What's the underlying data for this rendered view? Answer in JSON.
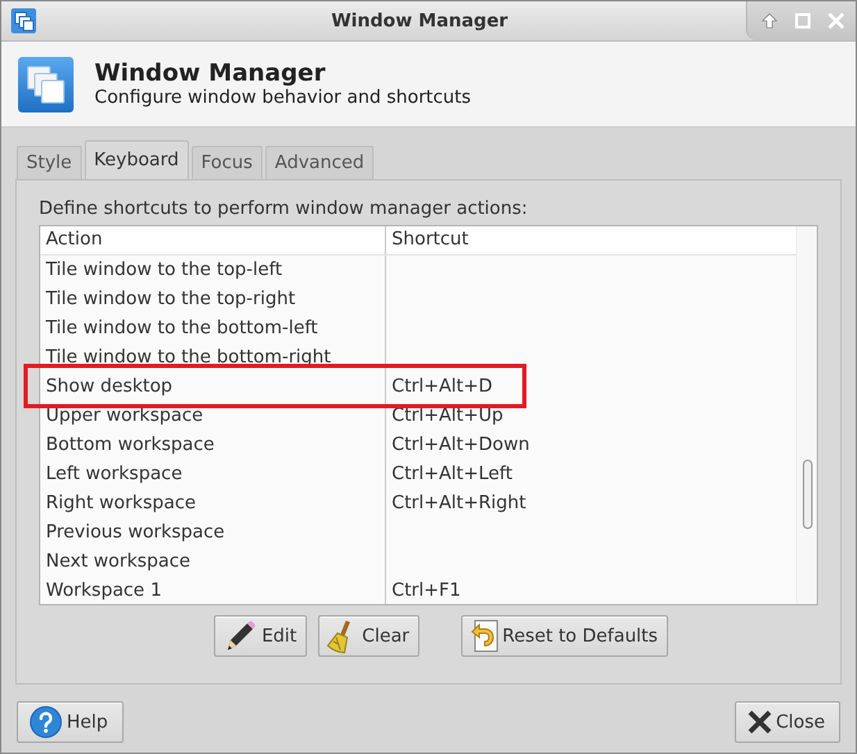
{
  "window": {
    "title": "Window Manager"
  },
  "header": {
    "title": "Window Manager",
    "subtitle": "Configure window behavior and shortcuts"
  },
  "tabs": [
    {
      "label": "Style",
      "selected": false
    },
    {
      "label": "Keyboard",
      "selected": true
    },
    {
      "label": "Focus",
      "selected": false
    },
    {
      "label": "Advanced",
      "selected": false
    }
  ],
  "instructions": "Define shortcuts to perform window manager actions:",
  "table": {
    "columns": [
      "Action",
      "Shortcut"
    ],
    "rows": [
      {
        "action": "Tile window to the top-left",
        "shortcut": "",
        "highlighted": false
      },
      {
        "action": "Tile window to the top-right",
        "shortcut": "",
        "highlighted": false
      },
      {
        "action": "Tile window to the bottom-left",
        "shortcut": "",
        "highlighted": false
      },
      {
        "action": "Tile window to the bottom-right",
        "shortcut": "",
        "highlighted": false
      },
      {
        "action": "Show desktop",
        "shortcut": "Ctrl+Alt+D",
        "highlighted": true
      },
      {
        "action": "Upper workspace",
        "shortcut": "Ctrl+Alt+Up",
        "highlighted": false
      },
      {
        "action": "Bottom workspace",
        "shortcut": "Ctrl+Alt+Down",
        "highlighted": false
      },
      {
        "action": "Left workspace",
        "shortcut": "Ctrl+Alt+Left",
        "highlighted": false
      },
      {
        "action": "Right workspace",
        "shortcut": "Ctrl+Alt+Right",
        "highlighted": false
      },
      {
        "action": "Previous workspace",
        "shortcut": "",
        "highlighted": false
      },
      {
        "action": "Next workspace",
        "shortcut": "",
        "highlighted": false
      },
      {
        "action": "Workspace 1",
        "shortcut": "Ctrl+F1",
        "highlighted": false
      }
    ]
  },
  "actions": [
    {
      "kind": "edit",
      "label": "Edit"
    },
    {
      "kind": "clear",
      "label": "Clear"
    },
    {
      "kind": "reset",
      "label": "Reset to Defaults"
    }
  ],
  "footer": [
    {
      "kind": "help",
      "label": "Help"
    },
    {
      "kind": "close",
      "label": "Close"
    }
  ]
}
